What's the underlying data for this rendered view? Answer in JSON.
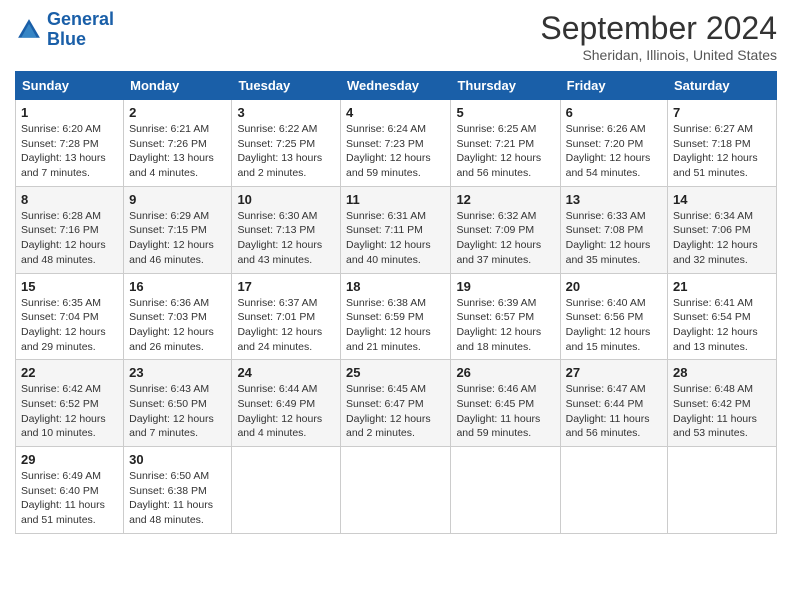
{
  "header": {
    "logo_line1": "General",
    "logo_line2": "Blue",
    "month": "September 2024",
    "location": "Sheridan, Illinois, United States"
  },
  "weekdays": [
    "Sunday",
    "Monday",
    "Tuesday",
    "Wednesday",
    "Thursday",
    "Friday",
    "Saturday"
  ],
  "weeks": [
    [
      {
        "day": "1",
        "info": "Sunrise: 6:20 AM\nSunset: 7:28 PM\nDaylight: 13 hours and 7 minutes."
      },
      {
        "day": "2",
        "info": "Sunrise: 6:21 AM\nSunset: 7:26 PM\nDaylight: 13 hours and 4 minutes."
      },
      {
        "day": "3",
        "info": "Sunrise: 6:22 AM\nSunset: 7:25 PM\nDaylight: 13 hours and 2 minutes."
      },
      {
        "day": "4",
        "info": "Sunrise: 6:24 AM\nSunset: 7:23 PM\nDaylight: 12 hours and 59 minutes."
      },
      {
        "day": "5",
        "info": "Sunrise: 6:25 AM\nSunset: 7:21 PM\nDaylight: 12 hours and 56 minutes."
      },
      {
        "day": "6",
        "info": "Sunrise: 6:26 AM\nSunset: 7:20 PM\nDaylight: 12 hours and 54 minutes."
      },
      {
        "day": "7",
        "info": "Sunrise: 6:27 AM\nSunset: 7:18 PM\nDaylight: 12 hours and 51 minutes."
      }
    ],
    [
      {
        "day": "8",
        "info": "Sunrise: 6:28 AM\nSunset: 7:16 PM\nDaylight: 12 hours and 48 minutes."
      },
      {
        "day": "9",
        "info": "Sunrise: 6:29 AM\nSunset: 7:15 PM\nDaylight: 12 hours and 46 minutes."
      },
      {
        "day": "10",
        "info": "Sunrise: 6:30 AM\nSunset: 7:13 PM\nDaylight: 12 hours and 43 minutes."
      },
      {
        "day": "11",
        "info": "Sunrise: 6:31 AM\nSunset: 7:11 PM\nDaylight: 12 hours and 40 minutes."
      },
      {
        "day": "12",
        "info": "Sunrise: 6:32 AM\nSunset: 7:09 PM\nDaylight: 12 hours and 37 minutes."
      },
      {
        "day": "13",
        "info": "Sunrise: 6:33 AM\nSunset: 7:08 PM\nDaylight: 12 hours and 35 minutes."
      },
      {
        "day": "14",
        "info": "Sunrise: 6:34 AM\nSunset: 7:06 PM\nDaylight: 12 hours and 32 minutes."
      }
    ],
    [
      {
        "day": "15",
        "info": "Sunrise: 6:35 AM\nSunset: 7:04 PM\nDaylight: 12 hours and 29 minutes."
      },
      {
        "day": "16",
        "info": "Sunrise: 6:36 AM\nSunset: 7:03 PM\nDaylight: 12 hours and 26 minutes."
      },
      {
        "day": "17",
        "info": "Sunrise: 6:37 AM\nSunset: 7:01 PM\nDaylight: 12 hours and 24 minutes."
      },
      {
        "day": "18",
        "info": "Sunrise: 6:38 AM\nSunset: 6:59 PM\nDaylight: 12 hours and 21 minutes."
      },
      {
        "day": "19",
        "info": "Sunrise: 6:39 AM\nSunset: 6:57 PM\nDaylight: 12 hours and 18 minutes."
      },
      {
        "day": "20",
        "info": "Sunrise: 6:40 AM\nSunset: 6:56 PM\nDaylight: 12 hours and 15 minutes."
      },
      {
        "day": "21",
        "info": "Sunrise: 6:41 AM\nSunset: 6:54 PM\nDaylight: 12 hours and 13 minutes."
      }
    ],
    [
      {
        "day": "22",
        "info": "Sunrise: 6:42 AM\nSunset: 6:52 PM\nDaylight: 12 hours and 10 minutes."
      },
      {
        "day": "23",
        "info": "Sunrise: 6:43 AM\nSunset: 6:50 PM\nDaylight: 12 hours and 7 minutes."
      },
      {
        "day": "24",
        "info": "Sunrise: 6:44 AM\nSunset: 6:49 PM\nDaylight: 12 hours and 4 minutes."
      },
      {
        "day": "25",
        "info": "Sunrise: 6:45 AM\nSunset: 6:47 PM\nDaylight: 12 hours and 2 minutes."
      },
      {
        "day": "26",
        "info": "Sunrise: 6:46 AM\nSunset: 6:45 PM\nDaylight: 11 hours and 59 minutes."
      },
      {
        "day": "27",
        "info": "Sunrise: 6:47 AM\nSunset: 6:44 PM\nDaylight: 11 hours and 56 minutes."
      },
      {
        "day": "28",
        "info": "Sunrise: 6:48 AM\nSunset: 6:42 PM\nDaylight: 11 hours and 53 minutes."
      }
    ],
    [
      {
        "day": "29",
        "info": "Sunrise: 6:49 AM\nSunset: 6:40 PM\nDaylight: 11 hours and 51 minutes."
      },
      {
        "day": "30",
        "info": "Sunrise: 6:50 AM\nSunset: 6:38 PM\nDaylight: 11 hours and 48 minutes."
      },
      null,
      null,
      null,
      null,
      null
    ]
  ]
}
